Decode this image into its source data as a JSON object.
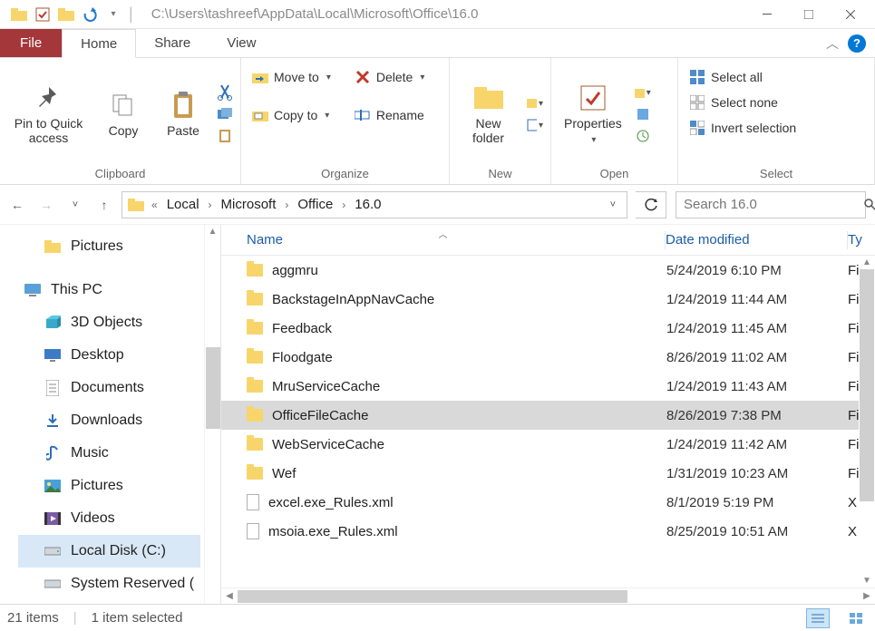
{
  "titlebar": {
    "path": "C:\\Users\\tashreef\\AppData\\Local\\Microsoft\\Office\\16.0",
    "qat_dropdown": "▾"
  },
  "tabs": {
    "file": "File",
    "home": "Home",
    "share": "Share",
    "view": "View"
  },
  "ribbon": {
    "clipboard": {
      "label": "Clipboard",
      "pin": "Pin to Quick access",
      "copy": "Copy",
      "paste": "Paste"
    },
    "organize": {
      "label": "Organize",
      "move_to": "Move to",
      "copy_to": "Copy to",
      "delete": "Delete",
      "rename": "Rename"
    },
    "new": {
      "label": "New",
      "new_folder": "New folder"
    },
    "open": {
      "label": "Open",
      "properties": "Properties"
    },
    "select": {
      "label": "Select",
      "select_all": "Select all",
      "select_none": "Select none",
      "invert": "Invert selection"
    }
  },
  "breadcrumb": {
    "overflow": "«",
    "items": [
      "Local",
      "Microsoft",
      "Office",
      "16.0"
    ]
  },
  "search": {
    "placeholder": "Search 16.0"
  },
  "navpane": {
    "pictures": "Pictures",
    "this_pc": "This PC",
    "items": [
      "3D Objects",
      "Desktop",
      "Documents",
      "Downloads",
      "Music",
      "Pictures",
      "Videos",
      "Local Disk (C:)",
      "System Reserved ("
    ]
  },
  "columns": {
    "name": "Name",
    "date": "Date modified",
    "type": "Ty"
  },
  "rows": [
    {
      "name": "aggmru",
      "date": "5/24/2019 6:10 PM",
      "type": "Fi",
      "icon": "folder",
      "selected": false
    },
    {
      "name": "BackstageInAppNavCache",
      "date": "1/24/2019 11:44 AM",
      "type": "Fi",
      "icon": "folder",
      "selected": false
    },
    {
      "name": "Feedback",
      "date": "1/24/2019 11:45 AM",
      "type": "Fi",
      "icon": "folder",
      "selected": false
    },
    {
      "name": "Floodgate",
      "date": "8/26/2019 11:02 AM",
      "type": "Fi",
      "icon": "folder",
      "selected": false
    },
    {
      "name": "MruServiceCache",
      "date": "1/24/2019 11:43 AM",
      "type": "Fi",
      "icon": "folder",
      "selected": false
    },
    {
      "name": "OfficeFileCache",
      "date": "8/26/2019 7:38 PM",
      "type": "Fi",
      "icon": "folder",
      "selected": true
    },
    {
      "name": "WebServiceCache",
      "date": "1/24/2019 11:42 AM",
      "type": "Fi",
      "icon": "folder",
      "selected": false
    },
    {
      "name": "Wef",
      "date": "1/31/2019 10:23 AM",
      "type": "Fi",
      "icon": "folder",
      "selected": false
    },
    {
      "name": "excel.exe_Rules.xml",
      "date": "8/1/2019 5:19 PM",
      "type": "X",
      "icon": "file",
      "selected": false
    },
    {
      "name": "msoia.exe_Rules.xml",
      "date": "8/25/2019 10:51 AM",
      "type": "X",
      "icon": "file",
      "selected": false
    }
  ],
  "status": {
    "items": "21 items",
    "selected": "1 item selected"
  }
}
